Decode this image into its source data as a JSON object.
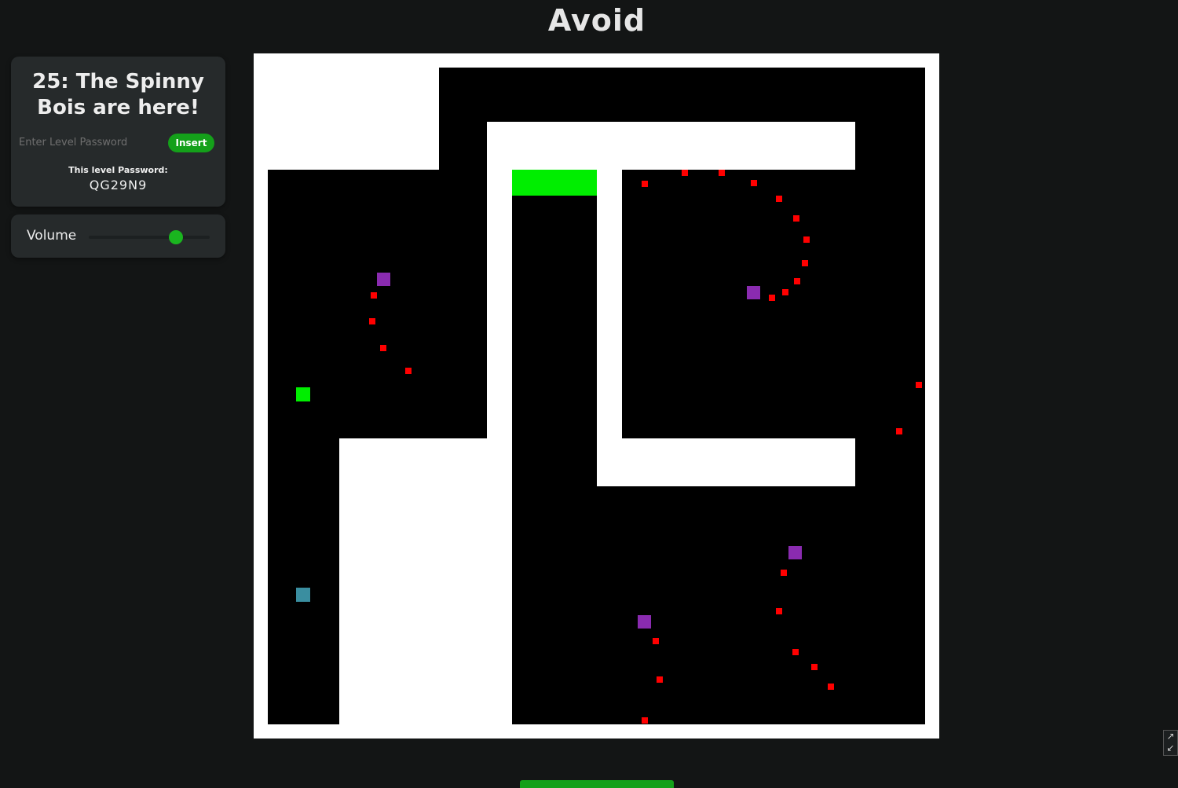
{
  "app": {
    "title": "Avoid"
  },
  "level_panel": {
    "level_name": "25: The Spinny Bois are here!",
    "password_placeholder": "Enter Level Password",
    "password_value": "",
    "insert_label": "Insert",
    "this_level_caption": "This level Password:",
    "this_level_password": "QG29N9"
  },
  "volume_panel": {
    "label": "Volume",
    "level": 0.72
  },
  "game": {
    "colors": {
      "floor": "#ffffff",
      "wall": "#000000",
      "goal": "#00ee00",
      "player": "#00ee00",
      "checkpoint": "#3a8ea0",
      "spinner_center": "#8a2bb0",
      "enemy": "#ff0000"
    },
    "level_number": 25
  },
  "controls": {
    "fullscreen_icon": "expand-icon",
    "bottom_button_color": "#14a01a"
  }
}
